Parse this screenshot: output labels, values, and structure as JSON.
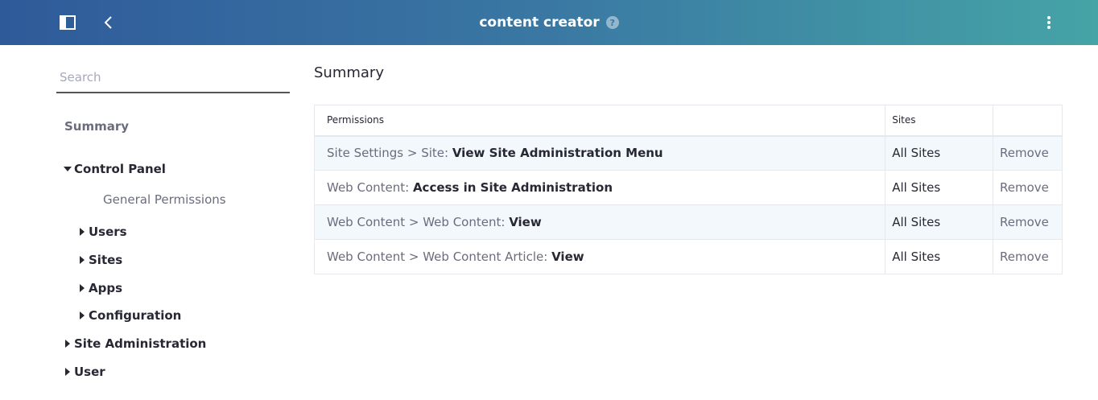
{
  "header": {
    "title": "content creator",
    "help_glyph": "?"
  },
  "sidebar": {
    "search_placeholder": "Search",
    "summary_label": "Summary",
    "control_panel": {
      "label": "Control Panel",
      "general_permissions": "General Permissions",
      "children": [
        "Users",
        "Sites",
        "Apps",
        "Configuration"
      ]
    },
    "site_administration": "Site Administration",
    "user": "User"
  },
  "main": {
    "title": "Summary",
    "columns": [
      "Permissions",
      "Sites",
      ""
    ],
    "rows": [
      {
        "path": "Site Settings > Site: ",
        "permission": "View Site Administration Menu",
        "sites": "All Sites",
        "action": "Remove"
      },
      {
        "path": "Web Content: ",
        "permission": "Access in Site Administration",
        "sites": "All Sites",
        "action": "Remove"
      },
      {
        "path": "Web Content > Web Content: ",
        "permission": "View",
        "sites": "All Sites",
        "action": "Remove"
      },
      {
        "path": "Web Content > Web Content Article: ",
        "permission": "View",
        "sites": "All Sites",
        "action": "Remove"
      }
    ]
  },
  "colors": {
    "header_start": "#2f5a9a",
    "header_end": "#45a4a6",
    "row_alt": "#f3f8fc",
    "muted_text": "#6b6c7e"
  }
}
